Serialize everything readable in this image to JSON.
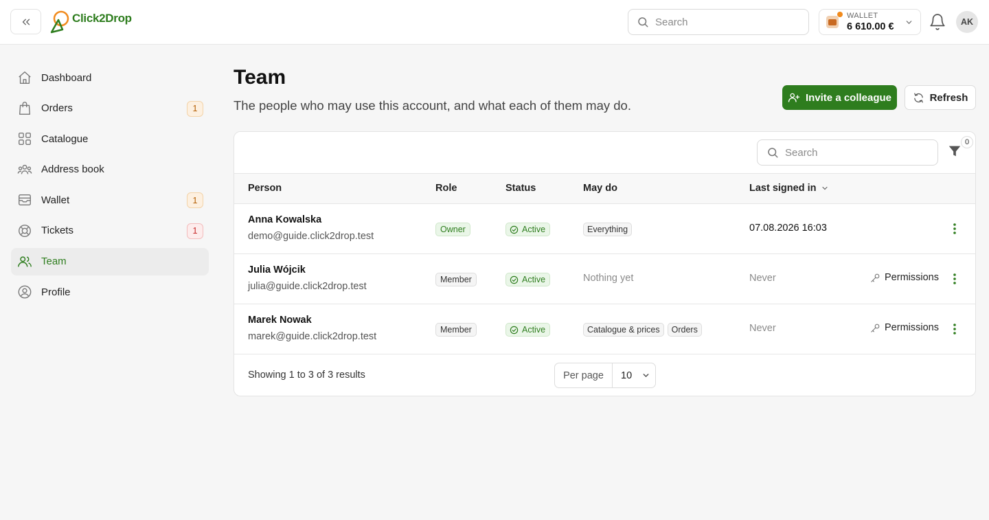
{
  "app": {
    "name": "Click2Drop",
    "search_placeholder": "Search",
    "wallet_label": "WALLET",
    "wallet_amount": "6 610.00 €",
    "avatar_initials": "AK",
    "brand_color": "#2e7d1e"
  },
  "sidebar": {
    "items": [
      {
        "label": "Dashboard",
        "icon": "home-icon",
        "badge": ""
      },
      {
        "label": "Orders",
        "icon": "bag-icon",
        "badge": "1"
      },
      {
        "label": "Catalogue",
        "icon": "grid-icon",
        "badge": ""
      },
      {
        "label": "Address book",
        "icon": "users-group-icon",
        "badge": ""
      },
      {
        "label": "Wallet",
        "icon": "inbox-icon",
        "badge": "1"
      },
      {
        "label": "Tickets",
        "icon": "lifebuoy-icon",
        "badge": "1"
      },
      {
        "label": "Team",
        "icon": "users-icon",
        "badge": ""
      },
      {
        "label": "Profile",
        "icon": "user-circle-icon",
        "badge": ""
      }
    ]
  },
  "page": {
    "title": "Team",
    "subtitle": "The people who may use this account, and what each of them may do.",
    "invite_label": "Invite a colleague",
    "refresh_label": "Refresh"
  },
  "table": {
    "search_placeholder": "Search",
    "filter_count": "0",
    "columns": {
      "person": "Person",
      "role": "Role",
      "status": "Status",
      "may_do": "May do",
      "last_signed_in": "Last signed in"
    },
    "rows": [
      {
        "name": "Anna Kowalska",
        "email": "demo@guide.click2drop.test",
        "role": "Owner",
        "status": "Active",
        "may_do": [
          "Everything"
        ],
        "may_do_text": "",
        "last_signed_in": "07.08.2026 16:03",
        "action": ""
      },
      {
        "name": "Julia Wójcik",
        "email": "julia@guide.click2drop.test",
        "role": "Member",
        "status": "Active",
        "may_do": [],
        "may_do_text": "Nothing yet",
        "last_signed_in": "Never",
        "action": "Permissions"
      },
      {
        "name": "Marek Nowak",
        "email": "marek@guide.click2drop.test",
        "role": "Member",
        "status": "Active",
        "may_do": [
          "Catalogue & prices",
          "Orders"
        ],
        "may_do_text": "",
        "last_signed_in": "Never",
        "action": "Permissions"
      }
    ],
    "footer": {
      "results_text": "Showing 1 to 3 of 3 results",
      "per_page_label": "Per page",
      "per_page_value": "10"
    }
  }
}
